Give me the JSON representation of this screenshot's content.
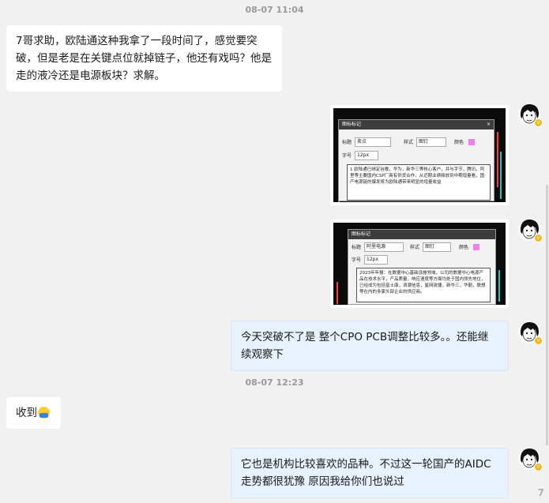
{
  "timestamps": [
    "08-07 11:04",
    "08-07 12:23"
  ],
  "messages": {
    "m1": "7哥求助，欧陆通这种我拿了一段时间了，感觉要突破，但是老是在关键点位就掉链子，他还有戏吗？他是走的液冷还是电源板块？求解。",
    "m4": "今天突破不了是 整个CPO PCB调整比较多。。还能继续观察下",
    "m5": "收到",
    "m6": "它也是机构比较喜欢的品种。不过这一轮国产的AIDC走势都很犹豫 原因我给你们也说过"
  },
  "image1": {
    "dialog_title": "图标标记",
    "close": "×",
    "title_label": "标题",
    "title_value": "卖点",
    "style_label": "样式",
    "style_value": "图钉",
    "color_label": "颜色",
    "size_label": "字号",
    "size_value": "12px",
    "body": "1 欧陆通已绑定谷歌，华为，新华三等核心客户，并与字节，腾讯，阿里等主要国内CSP厂商有供货合作，从近期业绩释放到中期增量看，国产电源链的爆发将为欧陆通带来明显的增量收益"
  },
  "image2": {
    "dialog_title": "图标标记",
    "title_label": "标题",
    "title_value": "阿里电源",
    "style_label": "样式",
    "style_value": "图钉",
    "color_label": "颜色",
    "size_label": "字号",
    "size_value": "12px",
    "body": "2023年年报：在数据中心基础设施领域，公司的数据中心电源产品在技术水平，产品质量，响应速度等方面均处于国内领先地位，已经成为包括富士康，浪潮信息，星网锐捷，新华三，华勤，联想等在内的多家头部企业的供应商。"
  },
  "watermark": "7",
  "colors": {
    "bubble_right": "#e6f2fd",
    "bubble_left": "#ffffff",
    "background": "#f1f1f1",
    "swatch": "#f07ef0"
  }
}
